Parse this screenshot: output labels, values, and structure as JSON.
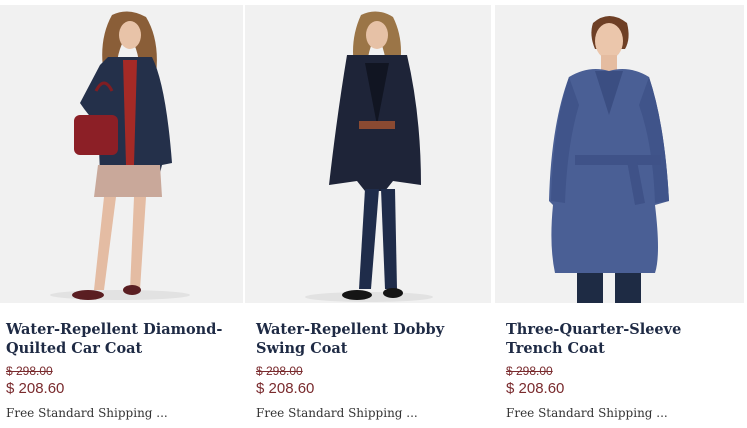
{
  "products": [
    {
      "title": "Water-Repellent Diamond-Quilted Car Coat",
      "original_price": "$ 298.00",
      "sale_price": "$ 208.60",
      "shipping": "Free Standard Shipping ..."
    },
    {
      "title": "Water-Repellent Dobby Swing Coat",
      "original_price": "$ 298.00",
      "sale_price": "$ 208.60",
      "shipping": "Free Standard Shipping ..."
    },
    {
      "title": "Three-Quarter-Sleeve Trench Coat",
      "original_price": "$ 298.00",
      "sale_price": "$ 208.60",
      "shipping": "Free Standard Shipping ..."
    }
  ],
  "colors": {
    "title": "#1e2a44",
    "price": "#7a2b2e",
    "shipping": "#333333",
    "image_bg": "#f1f1f1"
  }
}
